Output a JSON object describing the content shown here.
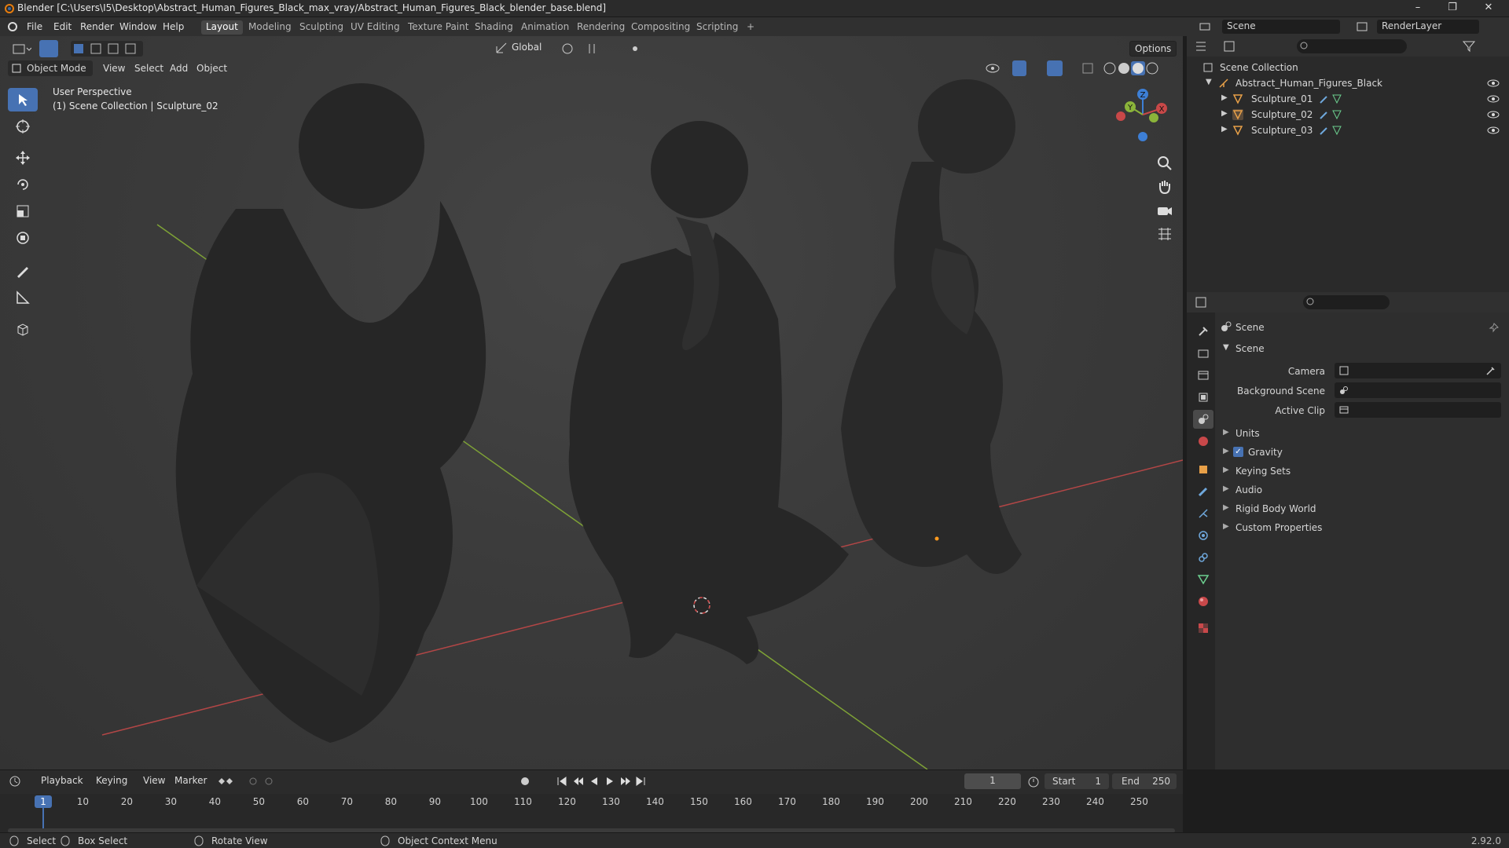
{
  "window": {
    "title": "Blender [C:\\Users\\I5\\Desktop\\Abstract_Human_Figures_Black_max_vray/Abstract_Human_Figures_Black_blender_base.blend]",
    "controls": [
      "–",
      "❐",
      "✕"
    ]
  },
  "menu": [
    "File",
    "Edit",
    "Render",
    "Window",
    "Help"
  ],
  "workspaces": [
    "Layout",
    "Modeling",
    "Sculpting",
    "UV Editing",
    "Texture Paint",
    "Shading",
    "Animation",
    "Rendering",
    "Compositing",
    "Scripting",
    "+"
  ],
  "active_workspace": "Layout",
  "scene_selector": {
    "label": "Scene",
    "renderlayer": "RenderLayer"
  },
  "viewport": {
    "transform_orientation": "Global",
    "options_label": "Options",
    "mode": "Object Mode",
    "header_menus": [
      "View",
      "Select",
      "Add",
      "Object"
    ],
    "overlay_line1": "User Perspective",
    "overlay_line2": "(1) Scene Collection | Sculpture_02",
    "gizmo_axes": [
      "Z",
      "Y",
      "X"
    ]
  },
  "outliner": {
    "root": "Scene Collection",
    "collection": "Abstract_Human_Figures_Black",
    "items": [
      "Sculpture_01",
      "Sculpture_02",
      "Sculpture_03"
    ]
  },
  "properties": {
    "header": "Scene",
    "panel": "Scene",
    "fields": [
      {
        "label": "Camera"
      },
      {
        "label": "Background Scene"
      },
      {
        "label": "Active Clip"
      }
    ],
    "subpanels": [
      "Units",
      "Gravity",
      "Keying Sets",
      "Audio",
      "Rigid Body World",
      "Custom Properties"
    ],
    "gravity_checked": true
  },
  "timeline": {
    "menus": [
      "Playback",
      "Keying",
      "View",
      "Marker"
    ],
    "current_frame": "1",
    "start_label": "Start",
    "start": "1",
    "end_label": "End",
    "end": "250",
    "ruler": [
      "1",
      "10",
      "20",
      "30",
      "40",
      "50",
      "60",
      "70",
      "80",
      "90",
      "100",
      "110",
      "120",
      "130",
      "140",
      "150",
      "160",
      "170",
      "180",
      "190",
      "200",
      "210",
      "220",
      "230",
      "240",
      "250"
    ]
  },
  "status": {
    "select": "Select",
    "box_select": "Box Select",
    "rotate": "Rotate View",
    "context": "Object Context Menu",
    "version": "2.92.0"
  },
  "colors": {
    "accent": "#4772b3",
    "x_axis": "#c84848",
    "y_axis": "#8bb43a",
    "z_axis": "#3d7fd6",
    "sculpture": "#262626"
  }
}
